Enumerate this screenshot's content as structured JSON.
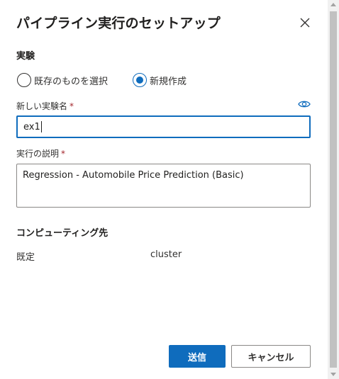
{
  "dialog": {
    "title": "パイプライン実行のセットアップ",
    "close_icon": "close-icon"
  },
  "experiment": {
    "section_label": "実験",
    "options": [
      {
        "label": "既存のものを選択",
        "selected": false
      },
      {
        "label": "新規作成",
        "selected": true
      }
    ]
  },
  "new_experiment_name": {
    "label": "新しい実験名",
    "required_marker": "*",
    "value": "ex1",
    "icon": "eye-icon"
  },
  "run_description": {
    "label": "実行の説明",
    "required_marker": "*",
    "value": "Regression - Automobile Price Prediction (Basic)"
  },
  "compute": {
    "heading": "コンピューティング先",
    "key": "既定",
    "value": "cluster"
  },
  "footer": {
    "submit_label": "送信",
    "cancel_label": "キャンセル"
  },
  "colors": {
    "accent": "#0f6cbd",
    "required": "#a4262c",
    "border": "#8a8886"
  }
}
